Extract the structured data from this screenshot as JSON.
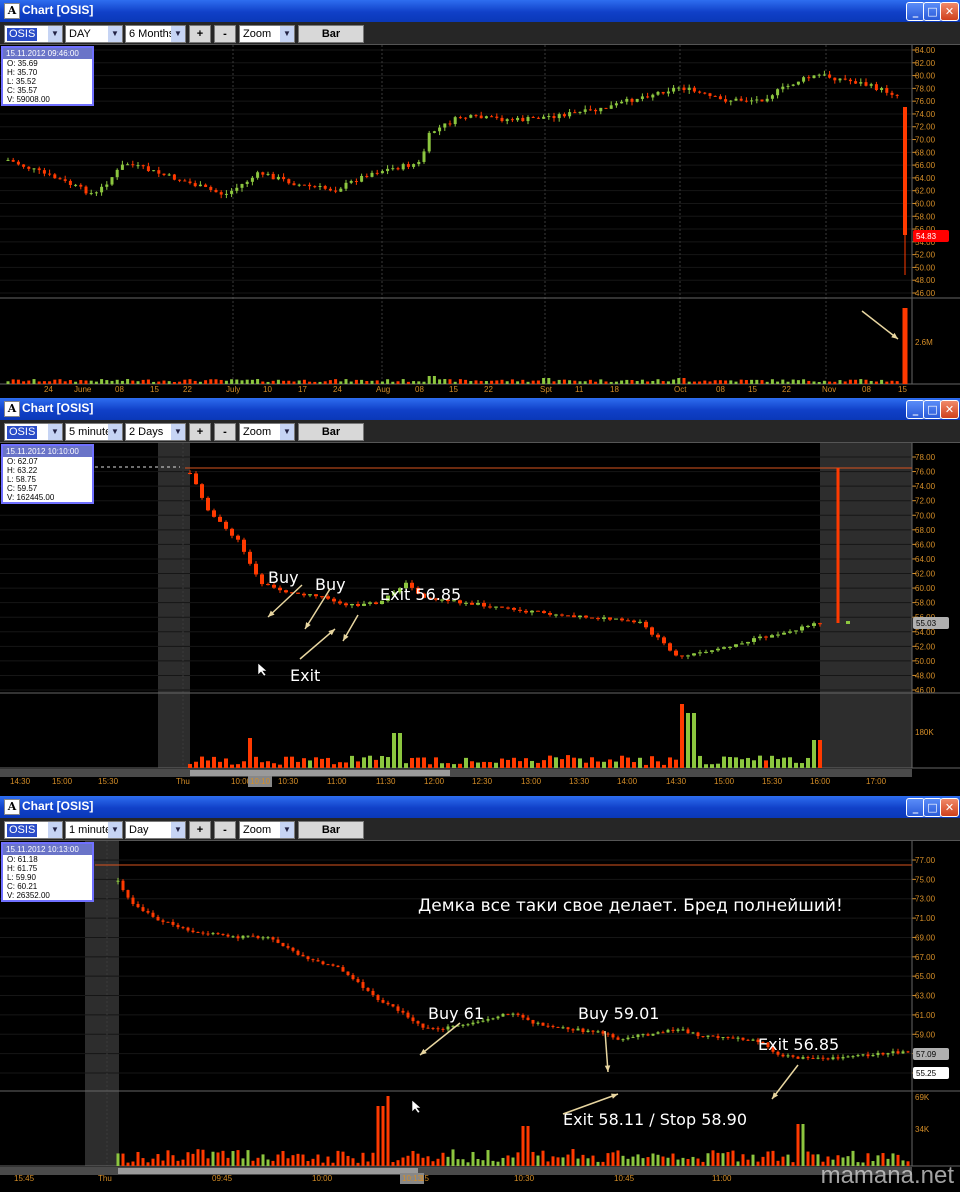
{
  "colors": {
    "up": "#8cc63f",
    "down": "#ff3a00",
    "line": "#d9531e",
    "axis": "#d58e28",
    "grid": "#555",
    "arrow": "#e8d6a0",
    "annot": "#ffffff",
    "panelShade": "#2d2d2d"
  },
  "charts": [
    {
      "window_title": "Chart [OSIS]",
      "toolbar": {
        "symbol": "OSIS",
        "interval": "DAY",
        "range": "6 Months",
        "plus": "+",
        "minus": "-",
        "zoom": "Zoom",
        "style": "Bar"
      },
      "info": {
        "datetime": "15.11.2012 09:46:00",
        "open": "O: 35.69",
        "high": "H: 35.70",
        "low": "L: 35.52",
        "close": "C: 35.57",
        "volume": "V: 59008.00"
      },
      "price_ticks": [
        "84.00",
        "82.00",
        "80.00",
        "78.00",
        "76.00",
        "74.00",
        "72.00",
        "70.00",
        "68.00",
        "66.00",
        "64.00",
        "62.00",
        "60.00",
        "58.00",
        "56.00",
        "54.00",
        "52.00",
        "50.00",
        "48.00",
        "46.00"
      ],
      "last_price_label": "54.83",
      "volume_label": "2.6M",
      "x_labels": [
        "24",
        "June",
        "08",
        "15",
        "22",
        "July",
        "10",
        "17",
        "24",
        "Aug",
        "08",
        "15",
        "22",
        "Spt",
        "11",
        "18",
        "Oct",
        "08",
        "15",
        "22",
        "Nov",
        "08",
        "15"
      ],
      "annotations": []
    },
    {
      "window_title": "Chart [OSIS]",
      "toolbar": {
        "symbol": "OSIS",
        "interval": "5 minutes",
        "range": "2 Days",
        "plus": "+",
        "minus": "-",
        "zoom": "Zoom",
        "style": "Bar"
      },
      "info": {
        "datetime": "15.11.2012 10:10:00",
        "open": "O: 62.07",
        "high": "H: 63.22",
        "low": "L: 58.75",
        "close": "C: 59.57",
        "volume": "V: 162445.00"
      },
      "price_ticks": [
        "78.00",
        "76.00",
        "74.00",
        "72.00",
        "70.00",
        "68.00",
        "66.00",
        "64.00",
        "62.00",
        "60.00",
        "58.00",
        "56.00",
        "54.00",
        "52.00",
        "50.00",
        "48.00",
        "46.00"
      ],
      "last_price_label": "55.03",
      "volume_label": "180K",
      "x_labels": [
        "14:30",
        "15:00",
        "15:30",
        "Thu",
        "10:00",
        "10:10",
        "10:30",
        "11:00",
        "11:30",
        "12:00",
        "12:30",
        "13:00",
        "13:30",
        "14:00",
        "14:30",
        "15:00",
        "15:30",
        "16:00",
        "17:00"
      ],
      "annotations": [
        "Buy",
        "Buy",
        "Exit",
        "Exit 56.85"
      ]
    },
    {
      "window_title": "Chart [OSIS]",
      "toolbar": {
        "symbol": "OSIS",
        "interval": "1 minute",
        "range": "Day",
        "plus": "+",
        "minus": "-",
        "zoom": "Zoom",
        "style": "Bar"
      },
      "info": {
        "datetime": "15.11.2012 10:13:00",
        "open": "O: 61.18",
        "high": "H: 61.75",
        "low": "L: 59.90",
        "close": "C: 60.21",
        "volume": "V: 26352.00"
      },
      "price_ticks": [
        "77.00",
        "75.00",
        "73.00",
        "71.00",
        "69.00",
        "67.00",
        "65.00",
        "63.00",
        "61.00",
        "59.00",
        "57.00",
        "55.00"
      ],
      "last_price_label": "57.09",
      "second_price_label": "55.25",
      "volume_label": "34K",
      "volume_top_label": "69K",
      "x_labels": [
        "15:45",
        "Thu",
        "09:45",
        "10:00",
        "10:13",
        "15",
        "10:30",
        "10:45",
        "11:00"
      ],
      "annotations": [
        "Демка все таки свое делает. Бред полнейший!",
        "Buy 61",
        "Buy 59.01",
        "Exit 56.85",
        "Exit 58.11 / Stop 58.90"
      ]
    }
  ],
  "watermark": "mamana.net"
}
